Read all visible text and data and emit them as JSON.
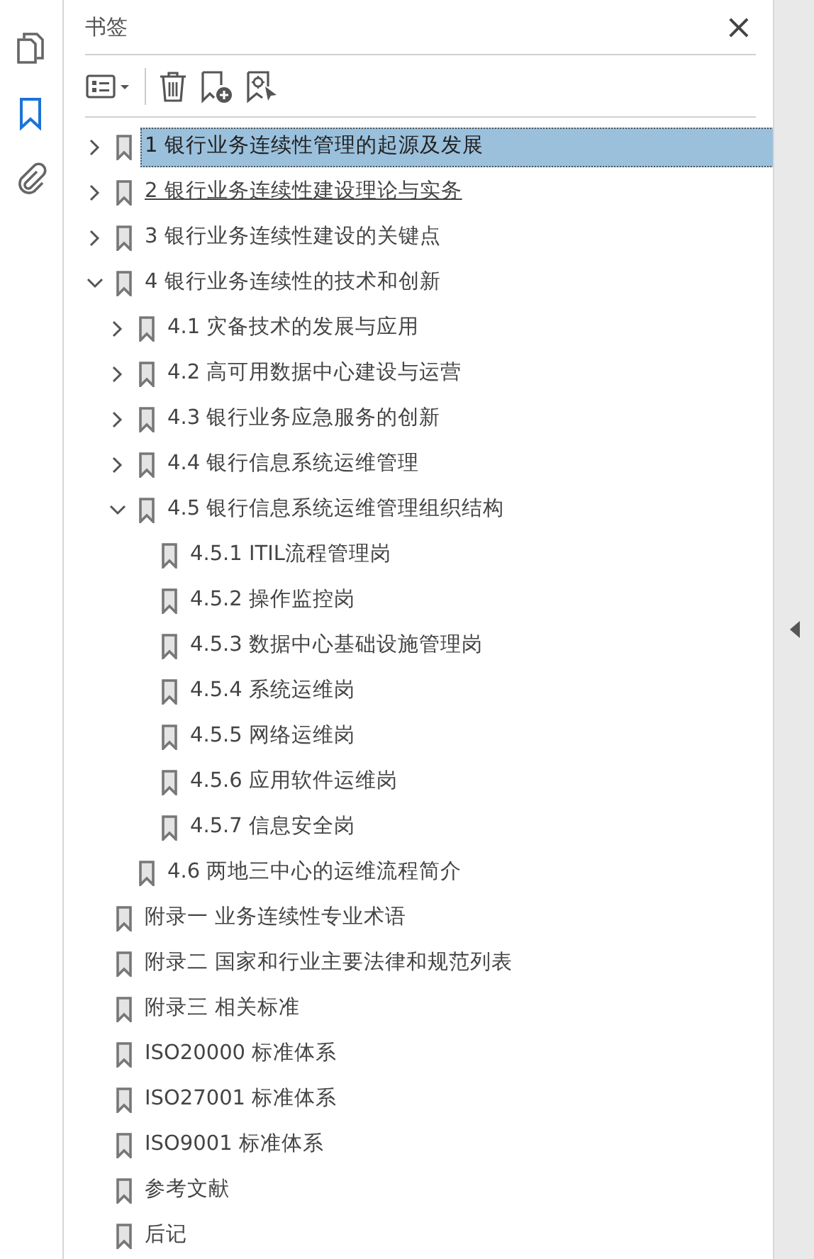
{
  "rail": [
    {
      "kind": "pages",
      "selected": false
    },
    {
      "kind": "bookmarks",
      "selected": true
    },
    {
      "kind": "attachments",
      "selected": false
    }
  ],
  "panel": {
    "title": "书签",
    "close": "×"
  },
  "bookmarks": [
    {
      "label": "1 银行业务连续性管理的起源及发展",
      "selected": true,
      "hovered": false,
      "expanded": false
    },
    {
      "label": "2 银行业务连续性建设理论与实务",
      "selected": false,
      "hovered": true,
      "expanded": false
    },
    {
      "label": "3 银行业务连续性建设的关键点",
      "selected": false,
      "hovered": false,
      "expanded": false
    },
    {
      "label": "4 银行业务连续性的技术和创新",
      "selected": false,
      "hovered": false,
      "expanded": true,
      "children": [
        {
          "label": "4.1 灾备技术的发展与应用",
          "selected": false,
          "hovered": false,
          "expanded": false
        },
        {
          "label": "4.2 高可用数据中心建设与运营",
          "selected": false,
          "hovered": false,
          "expanded": false
        },
        {
          "label": "4.3 银行业务应急服务的创新",
          "selected": false,
          "hovered": false,
          "expanded": false
        },
        {
          "label": "4.4 银行信息系统运维管理",
          "selected": false,
          "hovered": false,
          "expanded": false
        },
        {
          "label": "4.5 银行信息系统运维管理组织结构",
          "selected": false,
          "hovered": false,
          "expanded": true,
          "children": [
            {
              "label": "4.5.1 ITIL流程管理岗",
              "selected": false,
              "hovered": false
            },
            {
              "label": "4.5.2 操作监控岗",
              "selected": false,
              "hovered": false
            },
            {
              "label": "4.5.3 数据中心基础设施管理岗",
              "selected": false,
              "hovered": false
            },
            {
              "label": "4.5.4 系统运维岗",
              "selected": false,
              "hovered": false
            },
            {
              "label": "4.5.5 网络运维岗",
              "selected": false,
              "hovered": false
            },
            {
              "label": "4.5.6 应用软件运维岗",
              "selected": false,
              "hovered": false
            },
            {
              "label": "4.5.7 信息安全岗",
              "selected": false,
              "hovered": false
            }
          ]
        },
        {
          "label": "4.6 两地三中心的运维流程简介",
          "selected": false,
          "hovered": false
        }
      ]
    },
    {
      "label": "附录一 业务连续性专业术语",
      "selected": false,
      "hovered": false
    },
    {
      "label": "附录二 国家和行业主要法律和规范列表",
      "selected": false,
      "hovered": false
    },
    {
      "label": "附录三 相关标准",
      "selected": false,
      "hovered": false
    },
    {
      "label": "ISO20000 标准体系",
      "selected": false,
      "hovered": false
    },
    {
      "label": "ISO27001 标准体系",
      "selected": false,
      "hovered": false
    },
    {
      "label": "ISO9001 标准体系",
      "selected": false,
      "hovered": false
    },
    {
      "label": "参考文献",
      "selected": false,
      "hovered": false
    },
    {
      "label": "后记",
      "selected": false,
      "hovered": false
    }
  ]
}
